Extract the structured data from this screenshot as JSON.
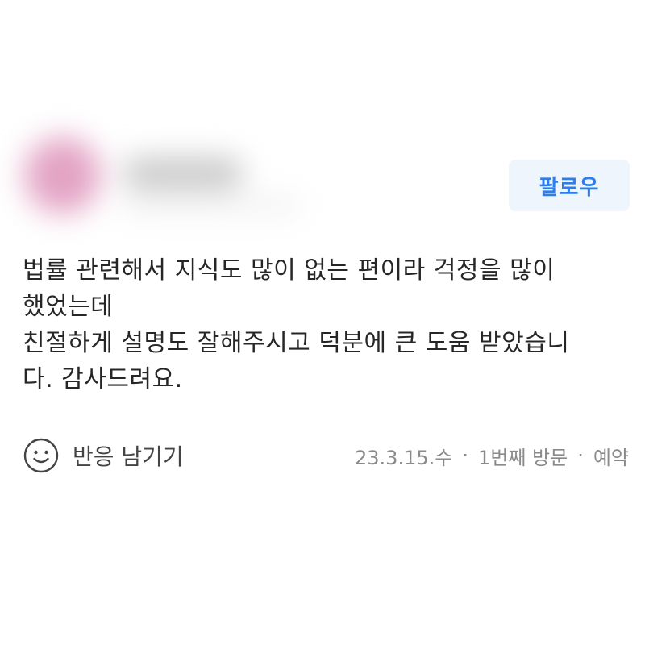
{
  "profile": {
    "follow_label": "팔로우"
  },
  "review": {
    "lines": [
      "법률 관련해서 지식도 많이 없는 편이라 걱정을 많이",
      "했었는데",
      "친절하게 설명도 잘해주시고 덕분에 큰 도움 받았습니",
      "다. 감사드려요."
    ]
  },
  "reaction": {
    "icon": "smile-icon",
    "label": "반응 남기기"
  },
  "meta": {
    "date": "23.3.15.수",
    "separator": "·",
    "visit": "1번째 방문",
    "type": "예약"
  },
  "colors": {
    "accent": "#2d7ee8",
    "follow_bg": "#eff5fc",
    "meta_text": "#8a8a8a"
  }
}
